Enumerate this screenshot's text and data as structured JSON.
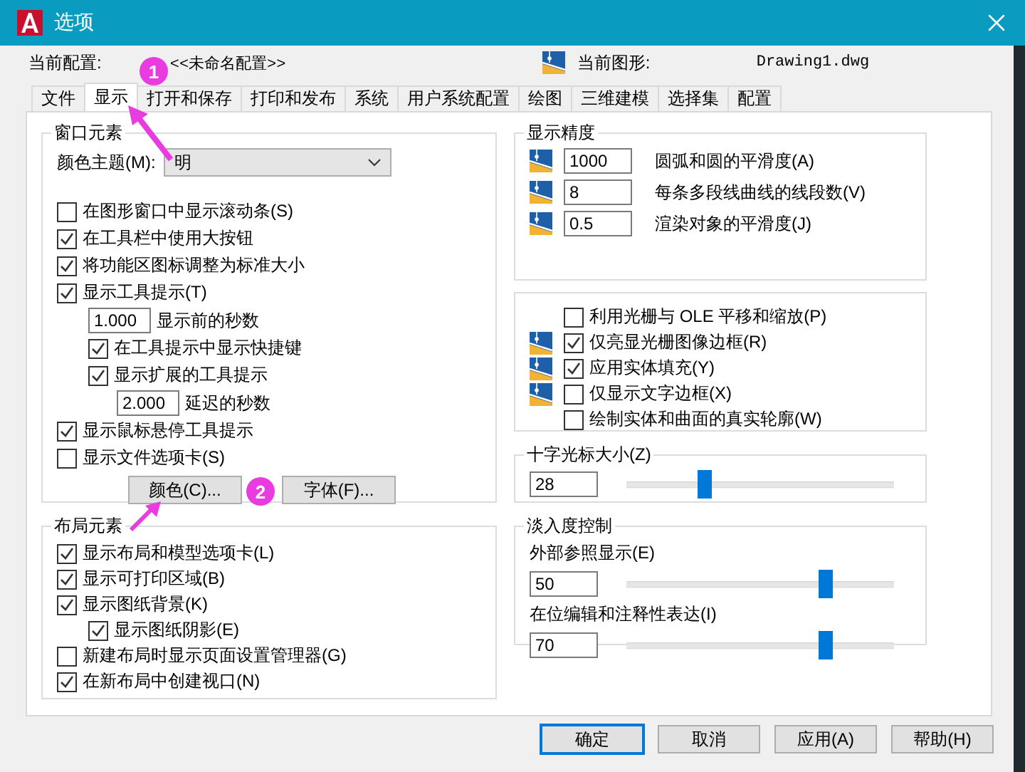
{
  "window": {
    "title": "选项"
  },
  "header": {
    "profile_label": "当前配置:",
    "profile_value": "<<未命名配置>>",
    "drawing_label": "当前图形:",
    "drawing_value": "Drawing1.dwg"
  },
  "tabs": [
    {
      "label": "文件",
      "selected": false
    },
    {
      "label": "显示",
      "selected": true
    },
    {
      "label": "打开和保存",
      "selected": false
    },
    {
      "label": "打印和发布",
      "selected": false
    },
    {
      "label": "系统",
      "selected": false
    },
    {
      "label": "用户系统配置",
      "selected": false
    },
    {
      "label": "绘图",
      "selected": false
    },
    {
      "label": "三维建模",
      "selected": false
    },
    {
      "label": "选择集",
      "selected": false
    },
    {
      "label": "配置",
      "selected": false
    }
  ],
  "window_elements": {
    "title": "窗口元素",
    "color_theme_label": "颜色主题(M):",
    "color_theme_value": "明",
    "items": [
      {
        "kind": "checkbox",
        "label": "在图形窗口中显示滚动条(S)",
        "checked": false
      },
      {
        "kind": "checkbox",
        "label": "在工具栏中使用大按钮",
        "checked": true
      },
      {
        "kind": "checkbox",
        "label": "将功能区图标调整为标准大小",
        "checked": true
      },
      {
        "kind": "checkbox",
        "label": "显示工具提示(T)",
        "checked": true,
        "children": [
          {
            "kind": "number",
            "value": "1.000",
            "label": "显示前的秒数"
          },
          {
            "kind": "checkbox",
            "label": "在工具提示中显示快捷键",
            "checked": true
          },
          {
            "kind": "checkbox",
            "label": "显示扩展的工具提示",
            "checked": true,
            "children": [
              {
                "kind": "number",
                "value": "2.000",
                "label": "延迟的秒数"
              }
            ]
          }
        ]
      },
      {
        "kind": "checkbox",
        "label": "显示鼠标悬停工具提示",
        "checked": true
      },
      {
        "kind": "checkbox",
        "label": "显示文件选项卡(S)",
        "checked": false
      }
    ],
    "buttons": [
      "颜色(C)...",
      "字体(F)..."
    ]
  },
  "layout_elements": {
    "title": "布局元素",
    "items": [
      {
        "kind": "checkbox",
        "label": "显示布局和模型选项卡(L)",
        "checked": true
      },
      {
        "kind": "checkbox",
        "label": "显示可打印区域(B)",
        "checked": true
      },
      {
        "kind": "checkbox",
        "label": "显示图纸背景(K)",
        "checked": true,
        "children": [
          {
            "kind": "checkbox",
            "label": "显示图纸阴影(E)",
            "checked": true
          }
        ]
      },
      {
        "kind": "checkbox",
        "label": "新建布局时显示页面设置管理器(G)",
        "checked": false
      },
      {
        "kind": "checkbox",
        "label": "在新布局中创建视口(N)",
        "checked": true
      }
    ]
  },
  "display_resolution": {
    "title": "显示精度",
    "items": [
      {
        "value": "1000",
        "label": "圆弧和圆的平滑度(A)"
      },
      {
        "value": "8",
        "label": "每条多段线曲线的线段数(V)"
      },
      {
        "value": "0.5",
        "label": "渲染对象的平滑度(J)"
      }
    ]
  },
  "display_performance": {
    "items": [
      {
        "label": "利用光栅与 OLE 平移和缩放(P)",
        "checked": false,
        "saved_in_drawing": false
      },
      {
        "label": "仅亮显光栅图像边框(R)",
        "checked": true,
        "saved_in_drawing": true
      },
      {
        "label": "应用实体填充(Y)",
        "checked": true,
        "saved_in_drawing": true
      },
      {
        "label": "仅显示文字边框(X)",
        "checked": false,
        "saved_in_drawing": true
      },
      {
        "label": "绘制实体和曲面的真实轮廓(W)",
        "checked": false,
        "saved_in_drawing": false
      }
    ]
  },
  "crosshair_size": {
    "title": "十字光标大小(Z)",
    "value": "28",
    "level": 0.28
  },
  "fade_control": {
    "title": "淡入度控制",
    "items": [
      {
        "label": "外部参照显示(E)",
        "value": "50",
        "level": 0.76
      },
      {
        "label": "在位编辑和注释性表达(I)",
        "value": "70",
        "level": 0.76
      }
    ]
  },
  "buttons": [
    {
      "label": "确定",
      "default": true
    },
    {
      "label": "取消",
      "default": false
    },
    {
      "label": "应用(A)",
      "default": false
    },
    {
      "label": "帮助(H)",
      "default": false
    }
  ],
  "annotations": [
    {
      "text": "1"
    },
    {
      "text": "2"
    }
  ]
}
